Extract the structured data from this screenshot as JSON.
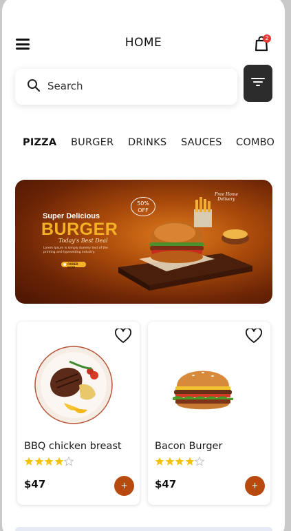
{
  "header": {
    "title": "HOME",
    "cart_badge": "2"
  },
  "search": {
    "placeholder": "Search"
  },
  "categories": [
    {
      "label": "PIZZA",
      "active": true
    },
    {
      "label": "BURGER",
      "active": false
    },
    {
      "label": "DRINKS",
      "active": false
    },
    {
      "label": "SAUCES",
      "active": false
    },
    {
      "label": "COMBO",
      "active": false
    }
  ],
  "banner": {
    "line1": "Super Delicious",
    "line2": "BURGER",
    "line3": "Today's Best Deal",
    "body": "Lorem Ipsum is simply dummy text of the printing and typesetting industry.",
    "button": "ORDER NOW",
    "badge": "50% OFF",
    "tag": "Free Home Delivery"
  },
  "products": [
    {
      "name": "BBQ chicken breast",
      "rating": 4,
      "max_rating": 5,
      "price": "$47",
      "add_label": "+",
      "icon": "steak-plate-icon"
    },
    {
      "name": "Bacon Burger",
      "rating": 4,
      "max_rating": 5,
      "price": "$47",
      "add_label": "+",
      "icon": "burger-icon"
    }
  ],
  "colors": {
    "accent": "#b84a10",
    "star": "#f4c20d",
    "dark_button": "#2c2c2c",
    "badge": "#e53935"
  }
}
